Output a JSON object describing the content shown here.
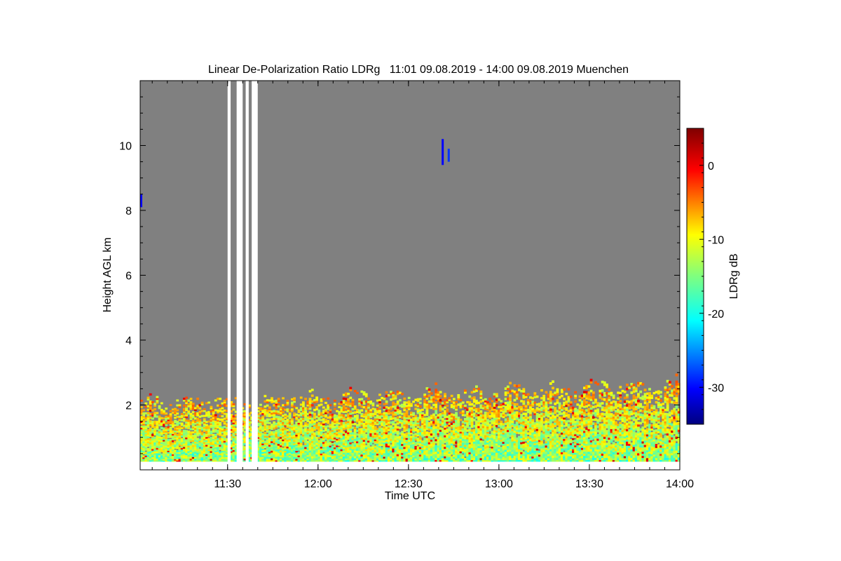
{
  "chart_data": {
    "type": "heatmap",
    "title": "Linear De-Polarization Ratio LDRg   11:01 09.08.2019 - 14:00 09.08.2019 Muenchen",
    "xlabel": "Time UTC",
    "ylabel": "Height AGL km",
    "x_range": [
      "11:01",
      "14:00"
    ],
    "x_ticks": [
      "11:30",
      "12:00",
      "12:30",
      "13:00",
      "13:30",
      "14:00"
    ],
    "ylim": [
      0,
      12
    ],
    "y_ticks": [
      2,
      4,
      6,
      8,
      10
    ],
    "background_color": "#808080",
    "colorbar": {
      "label": "LDRg dB",
      "range": [
        -35,
        5
      ],
      "ticks": [
        0,
        -10,
        -20,
        -30
      ],
      "colormap": "jet"
    },
    "missing_data_intervals": [
      {
        "start": "11:30",
        "end": "11:31"
      },
      {
        "start": "11:33",
        "end": "11:35"
      },
      {
        "start": "11:36",
        "end": "11:37"
      },
      {
        "start": "11:38",
        "end": "11:40"
      }
    ],
    "features": [
      {
        "time": "11:01",
        "height_km": [
          8.1,
          8.5
        ],
        "ldr_db": -30
      },
      {
        "time": "12:41",
        "height_km": [
          9.4,
          10.2
        ],
        "ldr_db": -30
      },
      {
        "time": "12:43",
        "height_km": [
          9.5,
          9.9
        ],
        "ldr_db": -28
      }
    ],
    "boundary_layer": {
      "top_km": [
        2.0,
        2.6
      ],
      "ldr_db_range": [
        -20,
        -5
      ]
    }
  }
}
